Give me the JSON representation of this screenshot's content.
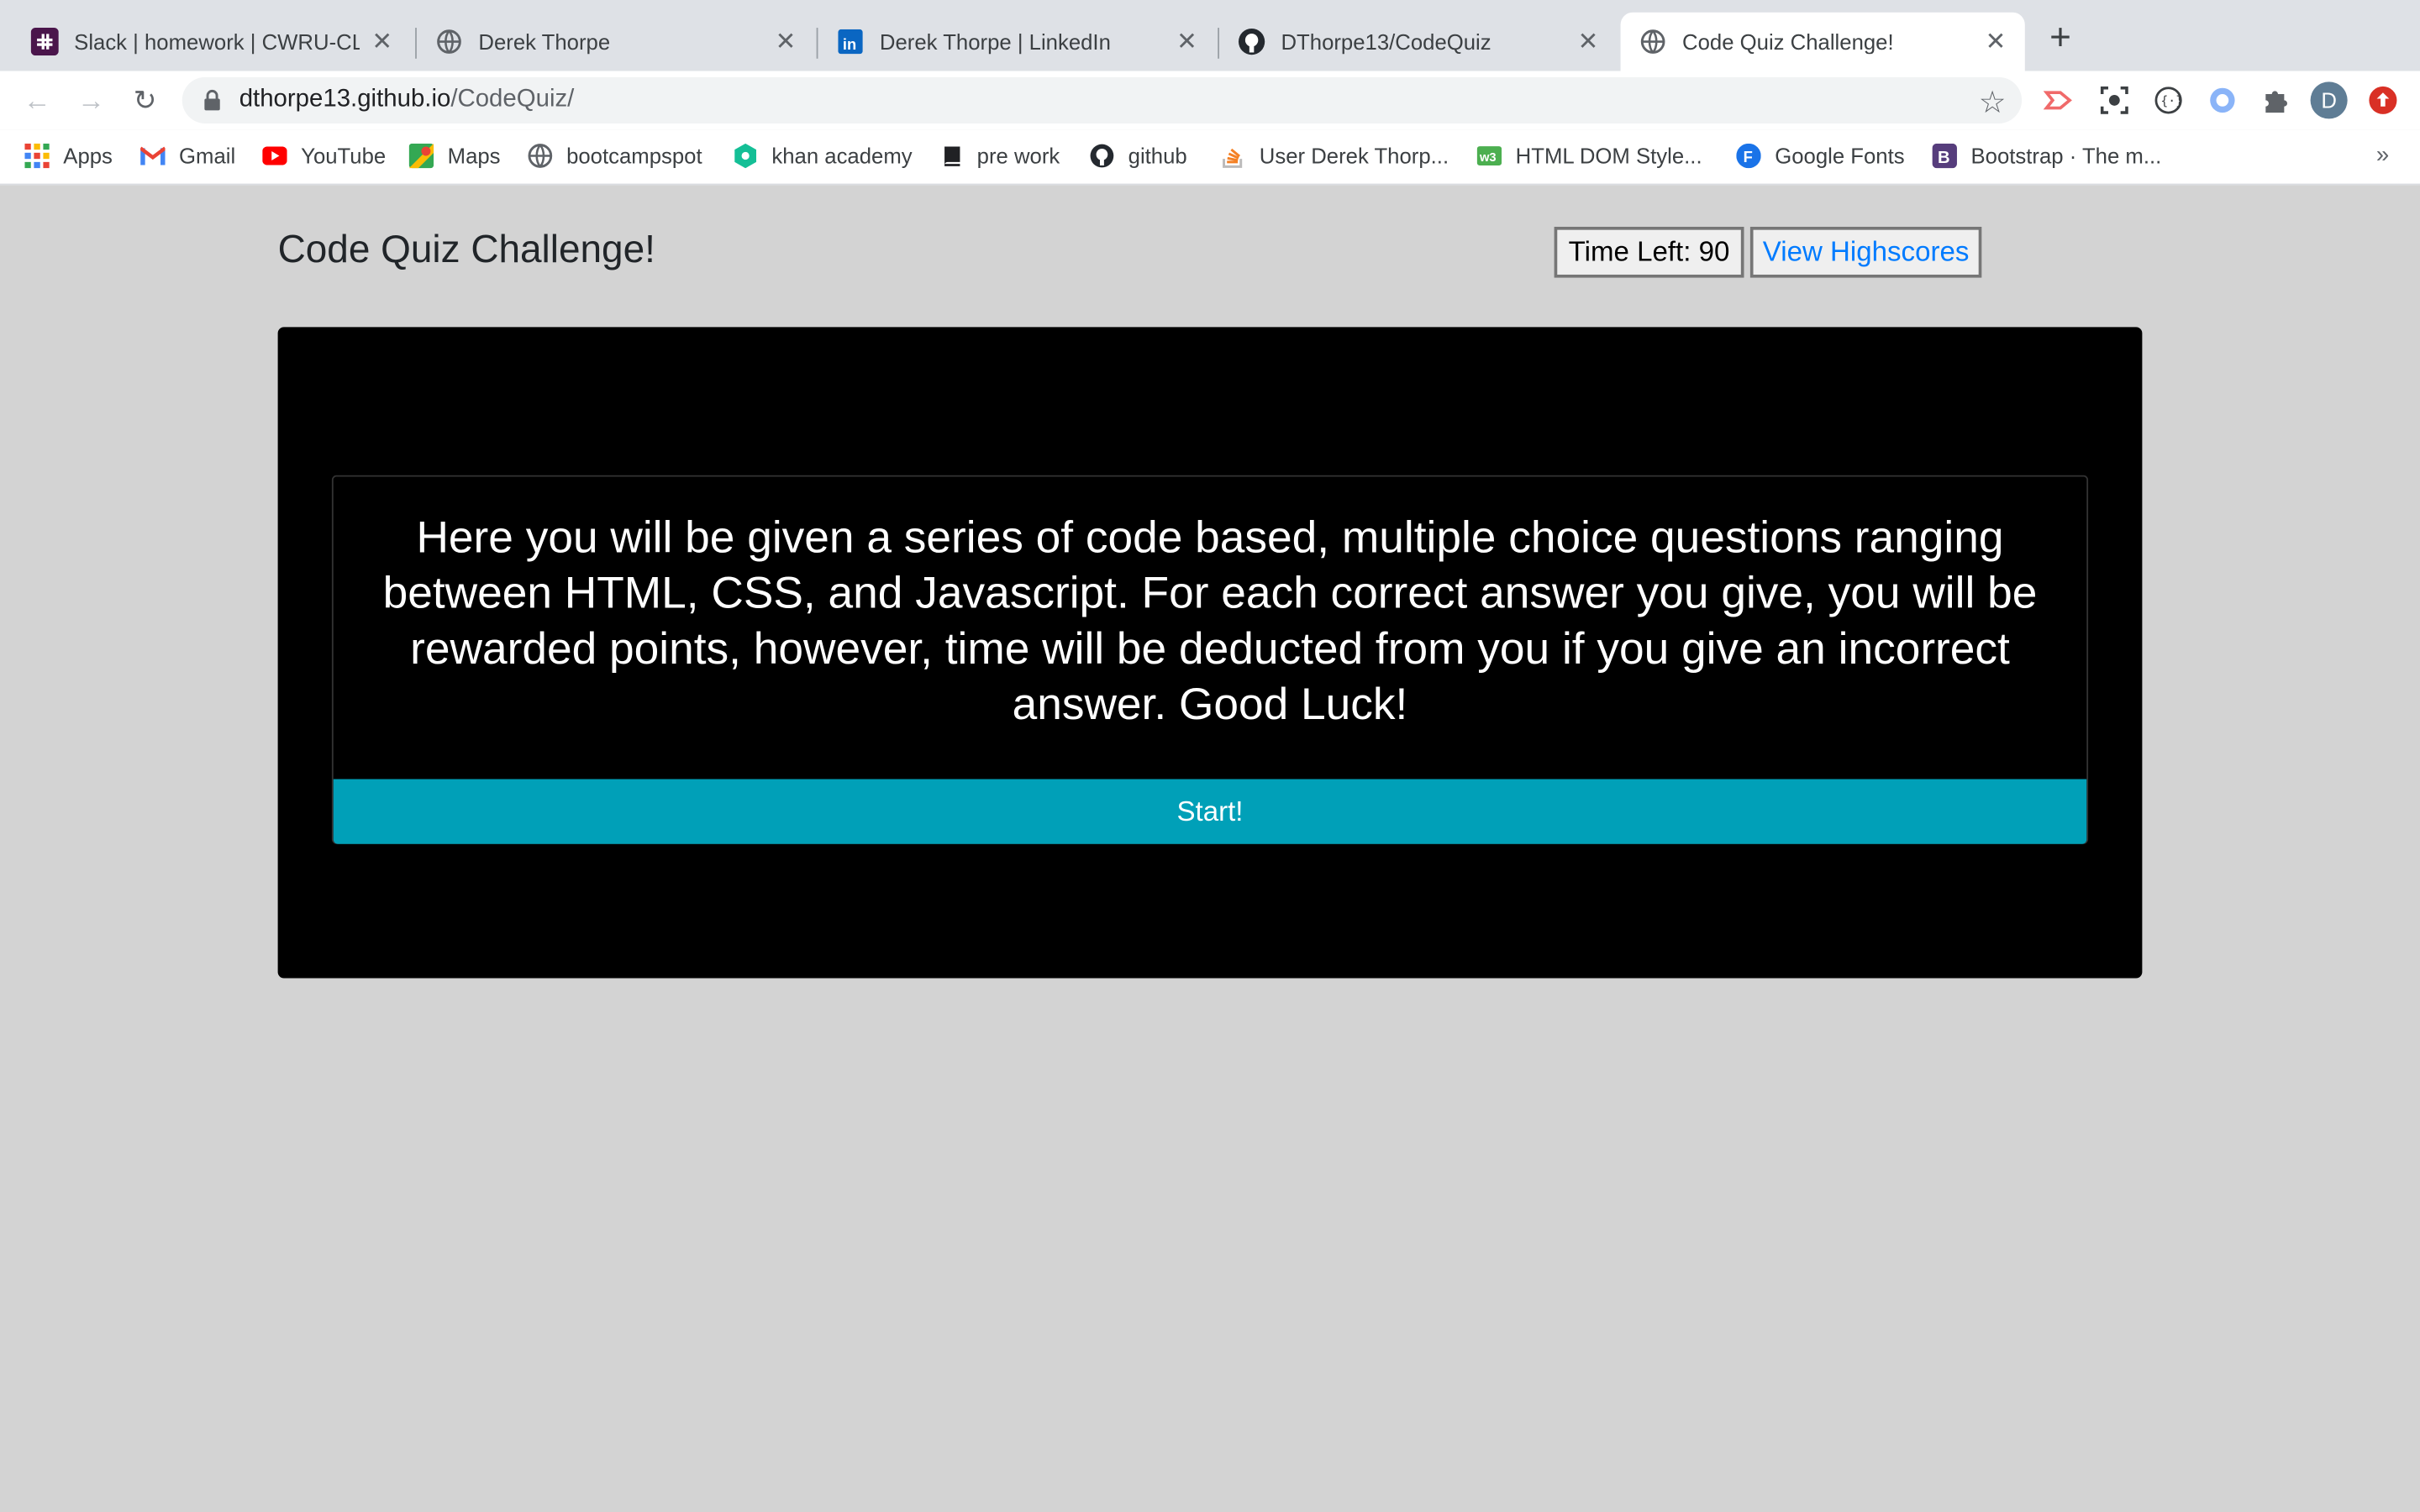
{
  "browser": {
    "tabs": [
      {
        "title": "Slack | homework | CWRU-CLE",
        "icon": "slack-icon"
      },
      {
        "title": "Derek Thorpe",
        "icon": "globe-icon"
      },
      {
        "title": "Derek Thorpe | LinkedIn",
        "icon": "linkedin-icon"
      },
      {
        "title": "DThorpe13/CodeQuiz",
        "icon": "github-icon"
      },
      {
        "title": "Code Quiz Challenge!",
        "icon": "globe-icon",
        "active": true
      }
    ],
    "new_tab": "+",
    "url_host": "dthorpe13.github.io",
    "url_path": "/CodeQuiz/",
    "profile_initial": "D",
    "bookmarks": [
      {
        "label": "Apps",
        "icon": "apps-grid-icon"
      },
      {
        "label": "Gmail",
        "icon": "gmail-icon"
      },
      {
        "label": "YouTube",
        "icon": "youtube-icon"
      },
      {
        "label": "Maps",
        "icon": "maps-icon"
      },
      {
        "label": "bootcampspot",
        "icon": "globe-icon"
      },
      {
        "label": "khan academy",
        "icon": "khan-academy-icon"
      },
      {
        "label": "pre work",
        "icon": "book-icon"
      },
      {
        "label": "github",
        "icon": "github-icon"
      },
      {
        "label": "User Derek Thorp...",
        "icon": "stackoverflow-icon"
      },
      {
        "label": "HTML DOM Style...",
        "icon": "w3schools-icon"
      },
      {
        "label": "Google Fonts",
        "icon": "google-fonts-icon"
      },
      {
        "label": "Bootstrap · The m...",
        "icon": "bootstrap-icon"
      }
    ],
    "more": "»"
  },
  "page": {
    "title": "Code Quiz Challenge!",
    "timer": "Time Left: 90",
    "highscores": "View Highscores",
    "intro": "Here you will be given a series of code based, multiple choice questions ranging between HTML, CSS, and Javascript. For each correct answer you give, you will be rewarded points, however, time will be deducted from you if you give an incorrect answer. Good Luck!",
    "start": "Start!"
  },
  "colors": {
    "page_background": "#d3d3d3",
    "stage": "#000000",
    "start_button": "#00a0b8",
    "link": "#007bff"
  }
}
